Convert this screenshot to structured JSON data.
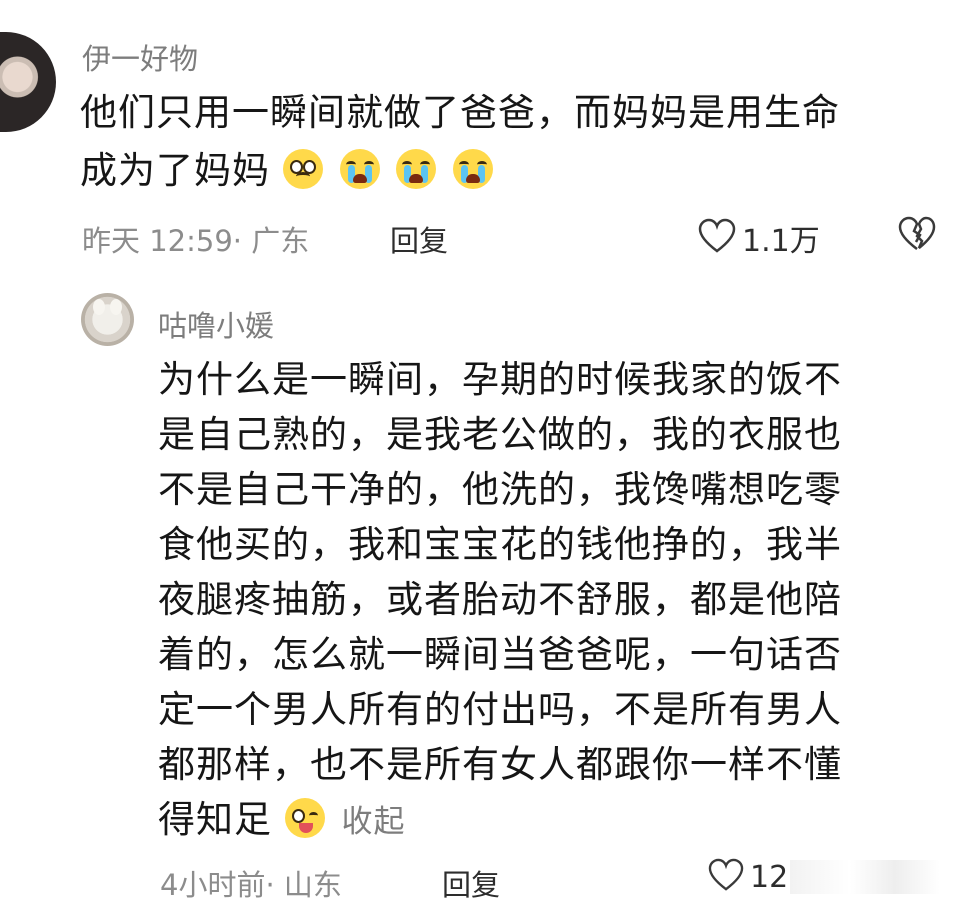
{
  "comment1": {
    "username": "伊一好物",
    "line1": "他们只用一瞬间就做了爸爸，而妈妈是用生命",
    "line2": "成为了妈妈",
    "time": "昨天 12:59",
    "location": "· 广东",
    "reply_label": "回复",
    "likes": "1.1万"
  },
  "comment2": {
    "username": "咕噜小媛",
    "lines": [
      "为什么是一瞬间，孕期的时候我家的饭不",
      "是自己熟的，是我老公做的，我的衣服也",
      "不是自己干净的，他洗的，我馋嘴想吃零",
      "食他买的，我和宝宝花的钱他挣的，我半",
      "夜腿疼抽筋，或者胎动不舒服，都是他陪",
      "着的，怎么就一瞬间当爸爸呢，一句话否",
      "定一个男人所有的付出吗，不是所有男人",
      "都那样，也不是所有女人都跟你一样不懂"
    ],
    "last_line": "得知足",
    "collapse_label": "收起",
    "time": "4小时前",
    "location": "· 山东",
    "reply_label": "回复",
    "likes": "12"
  },
  "colors": {
    "background": "#ffffff",
    "meta_gray": "#8c8c8c",
    "emoji_yellow": "#ffd94a",
    "tear_blue": "#5cc4f2"
  },
  "icons": [
    "heart-outline-icon",
    "broken-heart-icon",
    "disappointed-emoji",
    "crying-emoji",
    "wink-tongue-emoji"
  ]
}
